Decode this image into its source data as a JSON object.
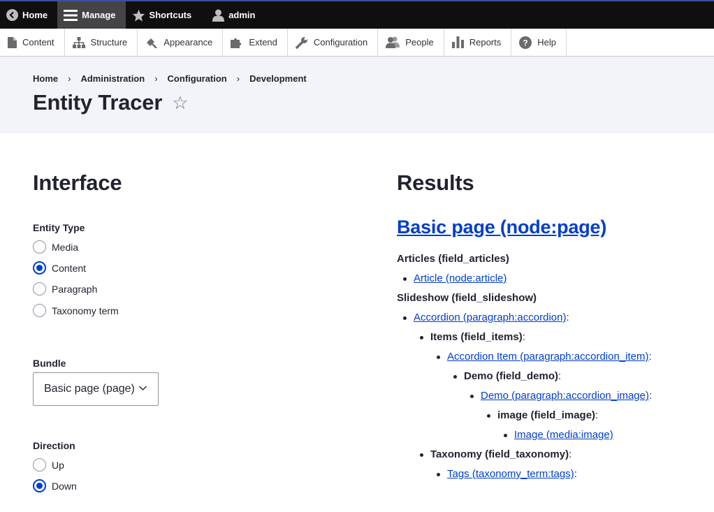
{
  "toolbar": {
    "home": "Home",
    "manage": "Manage",
    "shortcuts": "Shortcuts",
    "user": "admin"
  },
  "tray": {
    "items": [
      "Content",
      "Structure",
      "Appearance",
      "Extend",
      "Configuration",
      "People",
      "Reports",
      "Help"
    ]
  },
  "breadcrumb": [
    "Home",
    "Administration",
    "Configuration",
    "Development"
  ],
  "page_title": "Entity Tracer",
  "interface": {
    "title": "Interface",
    "entity_type": {
      "label": "Entity Type",
      "options": [
        "Media",
        "Content",
        "Paragraph",
        "Taxonomy term"
      ],
      "selected": "Content"
    },
    "bundle": {
      "label": "Bundle",
      "value": "Basic page (page)"
    },
    "direction": {
      "label": "Direction",
      "options": [
        "Up",
        "Down"
      ],
      "selected": "Down"
    }
  },
  "results": {
    "title": "Results",
    "root_link": "Basic page (node:page)",
    "articles_label": "Articles (field_articles)",
    "article_link": "Article (node:article)",
    "slideshow_label": "Slideshow (field_slideshow)",
    "accordion_link": "Accordion (paragraph:accordion)",
    "items_label": "Items (field_items)",
    "accordion_item_link": "Accordion Item (paragraph:accordion_item)",
    "demo_label": "Demo (field_demo)",
    "demo_link": "Demo (paragraph:accordion_image)",
    "image_label": "image (field_image)",
    "image_link": "Image (media:image)",
    "taxonomy_label": "Taxonomy (field_taxonomy)",
    "tags_link": "Tags (taxonomy_term:tags)",
    "colon": ":"
  },
  "colors": {
    "link": "#003ecc",
    "toolbar_bg": "#0f0f0f",
    "header_bg": "#f3f4f9"
  }
}
